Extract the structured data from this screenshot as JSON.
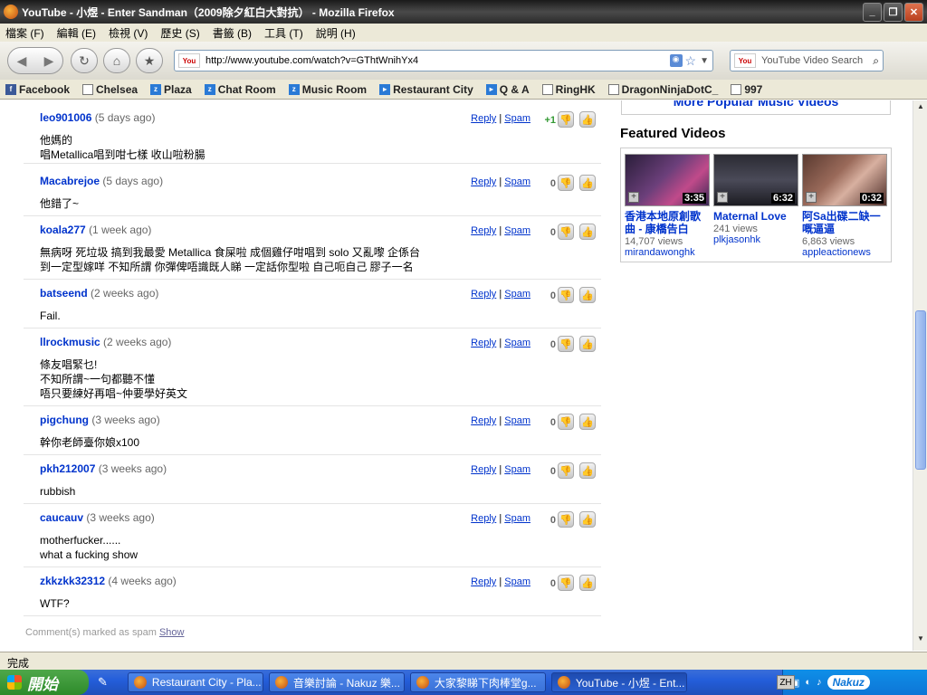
{
  "window": {
    "title": "YouTube - 小煜 - Enter Sandman（2009除夕紅白大對抗） - Mozilla Firefox"
  },
  "menu": [
    "檔案 (F)",
    "編輯 (E)",
    "檢視 (V)",
    "歷史 (S)",
    "書籤 (B)",
    "工具 (T)",
    "說明 (H)"
  ],
  "navbar": {
    "url": "http://www.youtube.com/watch?v=GThtWnihYx4",
    "search_placeholder": "YouTube Video Search"
  },
  "bookmarks": [
    "Facebook",
    "Chelsea",
    "Plaza",
    "Chat Room",
    "Music Room",
    "Restaurant City",
    "Q & A",
    "RingHK",
    "DragonNinjaDotC_",
    "997"
  ],
  "comments": [
    {
      "user": "leo901006",
      "time": "(5 days ago)",
      "score": "+1",
      "body": "他媽的\n唱Metallica唱到咁七樣 收山啦粉腸"
    },
    {
      "user": "Macabrejoe",
      "time": "(5 days ago)",
      "score": "0",
      "body": "他錯了~"
    },
    {
      "user": "koala277",
      "time": "(1 week ago)",
      "score": "0",
      "body": "無病呀 死垃圾 搞到我最愛 Metallica 食屎啦 成個雞仔咁唱到 solo 又亂嚟 企係台\n到一定型嫁咩 不知所謂 你彈俾唔識既人睇 一定話你型啦 自己呃自己 膠子一名"
    },
    {
      "user": "batseend",
      "time": "(2 weeks ago)",
      "score": "0",
      "body": "Fail."
    },
    {
      "user": "llrockmusic",
      "time": "(2 weeks ago)",
      "score": "0",
      "body": "條友唱緊乜!\n不知所謂~一句都聽不懂\n唔只要練好再唱~仲要學好英文"
    },
    {
      "user": "pigchung",
      "time": "(3 weeks ago)",
      "score": "0",
      "body": "幹你老師臺你娘x100"
    },
    {
      "user": "pkh212007",
      "time": "(3 weeks ago)",
      "score": "0",
      "body": "rubbish"
    },
    {
      "user": "caucauv",
      "time": "(3 weeks ago)",
      "score": "0",
      "body": "motherfucker......\nwhat a fucking show"
    },
    {
      "user": "zkkzkk32312",
      "time": "(4 weeks ago)",
      "score": "0",
      "body": "WTF?"
    }
  ],
  "comment_actions": {
    "reply": "Reply",
    "separator": "|",
    "spam": "Spam"
  },
  "spam_note": {
    "text": "Comment(s) marked as spam",
    "link": "Show"
  },
  "sidebar": {
    "more_popular": "More Popular Music Videos",
    "featured_title": "Featured Videos",
    "videos": [
      {
        "title": "香港本地原創歌曲 - 康橋告白",
        "views": "14,707 views",
        "owner": "mirandawonghk",
        "duration": "3:35"
      },
      {
        "title": "Maternal Love",
        "views": "241 views",
        "owner": "plkjasonhk",
        "duration": "6:32"
      },
      {
        "title": "阿Sa出碟二缺一嘅逼逼",
        "views": "6,863 views",
        "owner": "appleactionews",
        "duration": "0:32"
      }
    ]
  },
  "status": "完成",
  "taskbar": {
    "start": "開始",
    "tasks": [
      "Restaurant City - Pla...",
      "音樂討論 - Nakuz 樂...",
      "大家黎睇下肉棒堂g...",
      "YouTube - 小煜 - Ent..."
    ],
    "lang": "ZH",
    "tray_brand": "Nakuz"
  }
}
